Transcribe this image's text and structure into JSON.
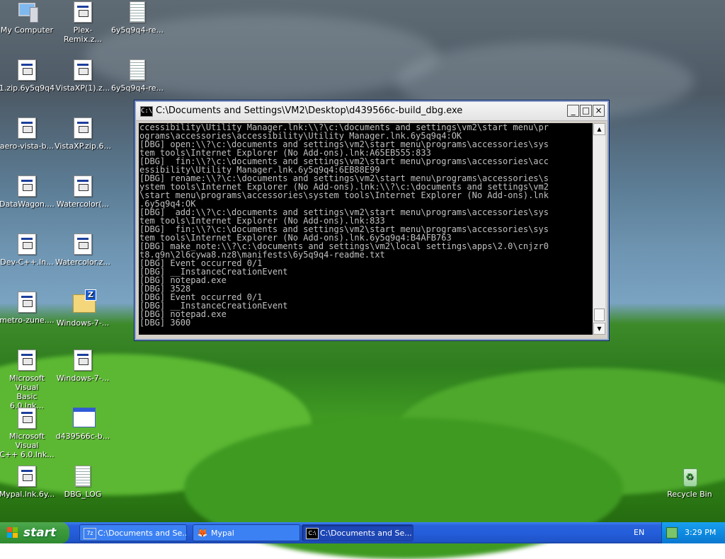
{
  "desktop": {
    "icons": [
      {
        "label": "My Computer",
        "glyph": "computer-icon"
      },
      {
        "label": "Plex-Remix.z...",
        "glyph": "program-icon"
      },
      {
        "label": "6y5q9q4-re...",
        "glyph": "text-document-icon"
      },
      {
        "label": "1.zip.6y5q9q4",
        "glyph": "program-icon"
      },
      {
        "label": "VistaXP(1).z...",
        "glyph": "program-icon"
      },
      {
        "label": "6y5q9q4-re...",
        "glyph": "text-document-icon"
      },
      {
        "label": "aero-vista-b...",
        "glyph": "program-icon"
      },
      {
        "label": "VistaXP.zip.6...",
        "glyph": "program-icon"
      },
      {
        "label": "DataWagon....",
        "glyph": "program-icon"
      },
      {
        "label": "Watercolor(...",
        "glyph": "program-icon"
      },
      {
        "label": "Dev-C++.ln...",
        "glyph": "program-icon"
      },
      {
        "label": "Watercolor.z...",
        "glyph": "program-icon"
      },
      {
        "label": "metro-zune....",
        "glyph": "program-icon"
      },
      {
        "label": "Windows-7-...",
        "glyph": "zip-folder-icon"
      },
      {
        "label": "Microsoft Visual\nBasic 6.0.lnk...",
        "glyph": "program-icon"
      },
      {
        "label": "Windows-7-...",
        "glyph": "program-icon"
      },
      {
        "label": "Microsoft Visual\nC++ 6.0.lnk...",
        "glyph": "program-icon"
      },
      {
        "label": "d439566c-b...",
        "glyph": "application-window-icon"
      },
      {
        "label": "Mypal.lnk.6y...",
        "glyph": "program-icon"
      },
      {
        "label": "DBG_LOG",
        "glyph": "text-document-icon"
      },
      {
        "label": "Recycle Bin",
        "glyph": "recycle-bin-icon"
      }
    ]
  },
  "console_window": {
    "title": "C:\\Documents and Settings\\VM2\\Desktop\\d439566c-build_dbg.exe",
    "icon_text": "C:\\",
    "lines": [
      "ccessibility\\Utility Manager.lnk:\\\\?\\c:\\documents and settings\\vm2\\start menu\\pr",
      "ograms\\accessories\\accessibility\\Utility Manager.lnk.6y5q9q4:OK",
      "[DBG] open:\\\\?\\c:\\documents and settings\\vm2\\start menu\\programs\\accessories\\sys",
      "tem tools\\Internet Explorer (No Add-ons).lnk:A65EB555:833",
      "[DBG]  fin:\\\\?\\c:\\documents and settings\\vm2\\start menu\\programs\\accessories\\acc",
      "essibility\\Utility Manager.lnk.6y5q9q4:6EB88E99",
      "[DBG] rename:\\\\?\\c:\\documents and settings\\vm2\\start menu\\programs\\accessories\\s",
      "ystem tools\\Internet Explorer (No Add-ons).lnk:\\\\?\\c:\\documents and settings\\vm2",
      "\\start menu\\programs\\accessories\\system tools\\Internet Explorer (No Add-ons).lnk",
      ".6y5q9q4:OK",
      "[DBG]  add:\\\\?\\c:\\documents and settings\\vm2\\start menu\\programs\\accessories\\sys",
      "tem tools\\Internet Explorer (No Add-ons).lnk:833",
      "[DBG]  fin:\\\\?\\c:\\documents and settings\\vm2\\start menu\\programs\\accessories\\sys",
      "tem tools\\Internet Explorer (No Add-ons).lnk.6y5q9q4:B4AFB763",
      "[DBG] make_note:\\\\?\\c:\\documents and settings\\vm2\\local settings\\apps\\2.0\\cnjzr0",
      "t8.q9n\\2l6cywa8.nz8\\manifests\\6y5q9q4-readme.txt",
      "[DBG] Event occurred 0/1",
      "[DBG] __InstanceCreationEvent",
      "[DBG] notepad.exe",
      "[DBG] 3528",
      "[DBG] Event occurred 0/1",
      "[DBG] __InstanceCreationEvent",
      "[DBG] notepad.exe",
      "[DBG] 3600"
    ],
    "buttons": {
      "minimize": "_",
      "maximize": "□",
      "close": "×"
    },
    "scroll": {
      "up": "▲",
      "down": "▼"
    }
  },
  "taskbar": {
    "start_label": "start",
    "tasks": [
      {
        "label": "C:\\Documents and Se...",
        "icon": "7z",
        "active": false
      },
      {
        "label": "Mypal",
        "icon": "mypal",
        "active": false
      },
      {
        "label": "C:\\Documents and Se...",
        "icon": "C:\\",
        "active": true
      }
    ],
    "language": "EN",
    "clock": "3:29 PM"
  },
  "colors": {
    "taskbar_blue": "#245edb",
    "start_green": "#3c9a3c",
    "console_bg": "#000000",
    "console_text": "#c0c0c0"
  }
}
